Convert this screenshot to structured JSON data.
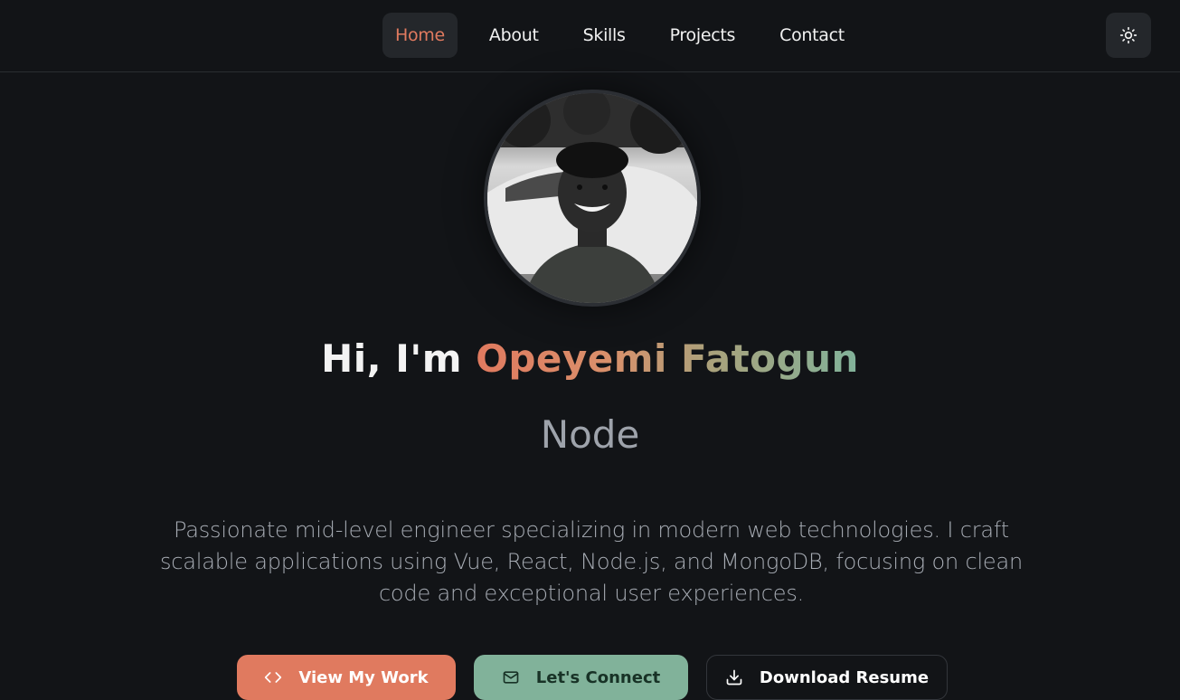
{
  "nav": {
    "links": [
      {
        "label": "Home",
        "active": true
      },
      {
        "label": "About",
        "active": false
      },
      {
        "label": "Skills",
        "active": false
      },
      {
        "label": "Projects",
        "active": false
      },
      {
        "label": "Contact",
        "active": false
      }
    ],
    "theme_toggle_icon": "sun-icon"
  },
  "hero": {
    "greeting": "Hi, I'm",
    "name": "Opeyemi Fatogun",
    "role": "Node",
    "bio": "Passionate mid-level engineer specializing in modern web technologies. I craft scalable applications using Vue, React, Node.js, and MongoDB, focusing on clean code and exceptional user experiences.",
    "buttons": {
      "view_work": {
        "label": "View My Work",
        "icon": "code-icon"
      },
      "connect": {
        "label": "Let's Connect",
        "icon": "mail-icon"
      },
      "resume": {
        "label": "Download Resume",
        "icon": "download-icon"
      }
    }
  },
  "colors": {
    "background": "#121417",
    "accent": "#e07a5f",
    "secondary": "#81b29a",
    "surface": "#24272b"
  }
}
